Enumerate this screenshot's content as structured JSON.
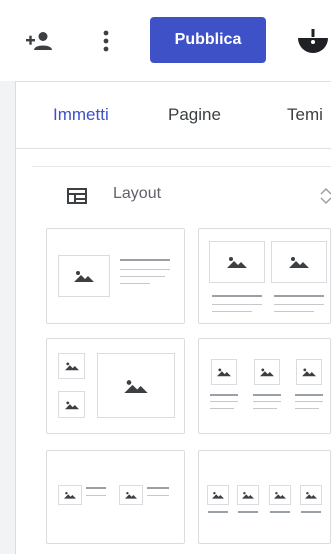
{
  "toolbar": {
    "add_user_icon": "person-add-icon",
    "more_icon": "vertical-dots-icon",
    "publish_label": "Pubblica",
    "avatar_icon": "avatar-icon"
  },
  "tabs": [
    {
      "label": "Immetti",
      "active": true
    },
    {
      "label": "Pagine",
      "active": false
    },
    {
      "label": "Temi",
      "active": false
    }
  ],
  "section": {
    "title": "Layout",
    "icon": "layout-grid-icon",
    "toggle_icon": "collapse-chevron-icon"
  },
  "layouts": [
    {
      "name": "image-left-text-right"
    },
    {
      "name": "two-images-with-captions"
    },
    {
      "name": "two-small-images-one-large"
    },
    {
      "name": "three-images-with-captions"
    },
    {
      "name": "two-image-text-pairs"
    },
    {
      "name": "four-images-with-captions"
    }
  ],
  "colors": {
    "accent": "#3f51c7",
    "rail": "#f1f3f4",
    "border": "#dadce0"
  }
}
